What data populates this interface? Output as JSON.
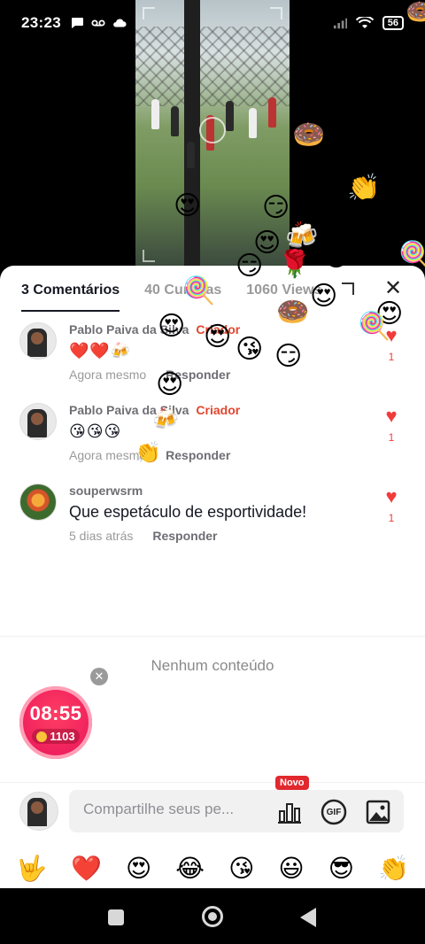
{
  "status_bar": {
    "time": "23:23",
    "battery": "56"
  },
  "tabs": [
    {
      "label": "3 Comentários"
    },
    {
      "label": "40 Curtidas"
    },
    {
      "label": "1060 Views"
    }
  ],
  "comments": [
    {
      "author": "Pablo Paiva da Silva",
      "badge": "Criador",
      "text": "❤️❤️🍻",
      "time": "Agora mesmo",
      "reply_label": "Responder",
      "likes": "1"
    },
    {
      "author": "Pablo Paiva da Silva",
      "badge": "Criador",
      "text": "😘😘😘",
      "time": "Agora mesmo",
      "reply_label": "Responder",
      "likes": "1"
    },
    {
      "author": "souperwsrm",
      "badge": "",
      "text": "Que espetáculo de esportividade!",
      "time": "5 dias atrás",
      "reply_label": "Responder",
      "likes": "1"
    }
  ],
  "empty_state": "Nenhum conteúdo",
  "timer": {
    "time": "08:55",
    "coins": "1103"
  },
  "input": {
    "placeholder": "Compartilhe seus pe...",
    "new_badge": "Novo",
    "gif_label": "GIF"
  },
  "quick_emojis": [
    "🤟",
    "❤️",
    "😍",
    "😂",
    "😘",
    "😃",
    "😎",
    "👏"
  ],
  "colors": {
    "accent": "#e2462d",
    "like": "#f23b3b",
    "timer": "#e7135b"
  }
}
